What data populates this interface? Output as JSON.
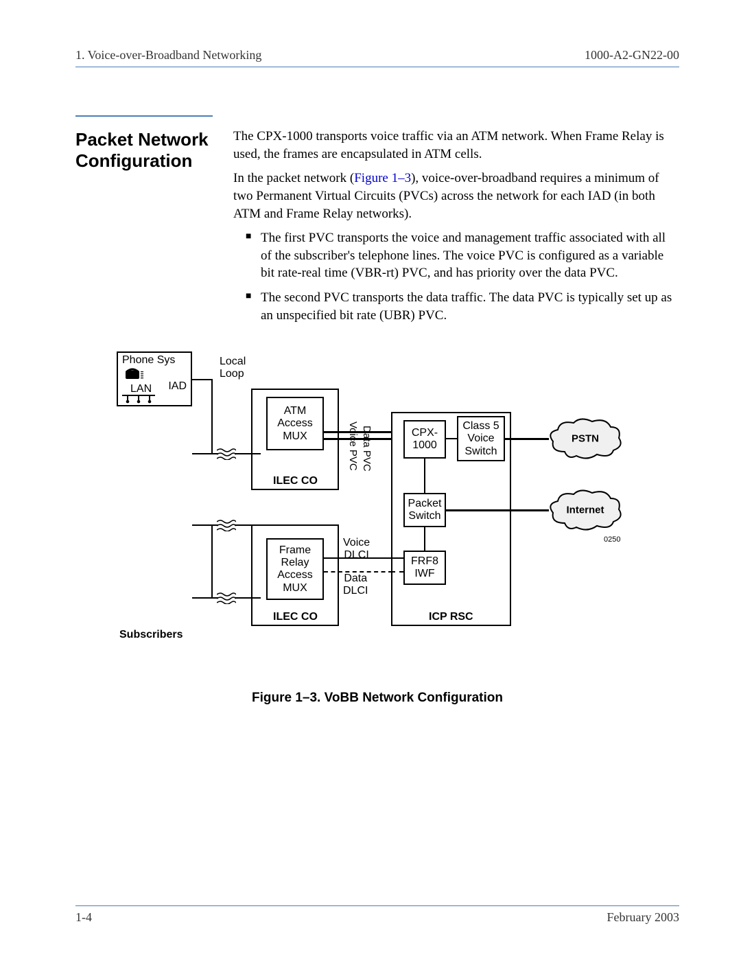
{
  "header": {
    "left": "1. Voice-over-Broadband Networking",
    "right": "1000-A2-GN22-00"
  },
  "section_title": "Packet Network Configuration",
  "para1": "The CPX-1000 transports voice traffic via an ATM network. When Frame Relay is used, the frames are encapsulated in ATM cells.",
  "para2a": "In the packet network (",
  "figref": "Figure 1–3",
  "para2b": "), voice-over-broadband requires a minimum of two Permanent Virtual Circuits (PVCs) across the network for each IAD (in both ATM and Frame Relay networks).",
  "bullet1": "The first PVC transports the voice and management traffic associated with all of the subscriber's telephone lines. The voice PVC is configured as a variable bit rate-real time (VBR-rt) PVC, and has priority over the data PVC.",
  "bullet2": "The second PVC transports the data traffic. The data PVC is typically set up as an unspecified bit rate (UBR) PVC.",
  "diagram": {
    "phone_sys": "Phone Sys",
    "lan": "LAN",
    "iad": "IAD",
    "local_loop": "Local\nLoop",
    "atm_mux": "ATM\nAccess\nMUX",
    "fr_mux": "Frame\nRelay\nAccess\nMUX",
    "ilec_co": "ILEC CO",
    "voice_pvc": "Voice PVC",
    "data_pvc": "Data PVC",
    "cpx": "CPX-\n1000",
    "class5": "Class 5\nVoice\nSwitch",
    "packet_switch": "Packet\nSwitch",
    "frf8": "FRF8\nIWF",
    "voice_dlci": "Voice\nDLCI",
    "data_dlci": "Data\nDLCI",
    "icp_rsc": "ICP RSC",
    "pstn": "PSTN",
    "internet": "Internet",
    "subscribers": "Subscribers",
    "fig_id": "0250"
  },
  "figure_caption": "Figure 1–3.  VoBB Network Configuration",
  "footer": {
    "left": "1-4",
    "right": "February 2003"
  }
}
